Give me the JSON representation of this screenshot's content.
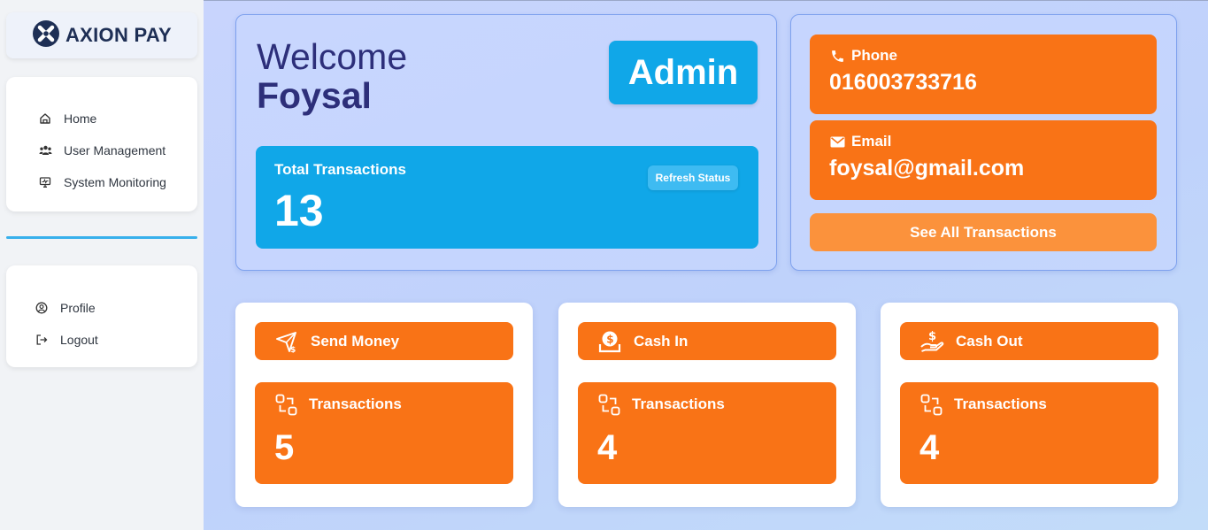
{
  "brand": {
    "name": "AXION PAY",
    "primary_color": "#1e2f55",
    "icon": "x-circle-logo"
  },
  "sidebar": {
    "top_items": [
      {
        "label": "Home",
        "icon": "home-icon"
      },
      {
        "label": "User Management",
        "icon": "users-icon"
      },
      {
        "label": "System Monitoring",
        "icon": "monitor-icon"
      }
    ],
    "bottom_items": [
      {
        "label": "Profile",
        "icon": "user-circle-icon"
      },
      {
        "label": "Logout",
        "icon": "logout-icon"
      }
    ],
    "divider_color": "#38b0ec"
  },
  "welcome": {
    "greeting": "Welcome",
    "name": "Foysal",
    "role_badge": "Admin"
  },
  "total_transactions": {
    "label": "Total Transactions",
    "value": "13",
    "refresh_label": "Refresh Status"
  },
  "contact": {
    "phone_label": "Phone",
    "phone_value": "016003733716",
    "email_label": "Email",
    "email_value": "foysal@gmail.com",
    "see_all_label": "See All Transactions"
  },
  "operations": [
    {
      "title": "Send Money",
      "icon": "send-money-icon",
      "tx_label": "Transactions",
      "tx_value": "5"
    },
    {
      "title": "Cash In",
      "icon": "cash-in-icon",
      "tx_label": "Transactions",
      "tx_value": "4"
    },
    {
      "title": "Cash Out",
      "icon": "cash-out-icon",
      "tx_label": "Transactions",
      "tx_value": "4"
    }
  ],
  "colors": {
    "accent_blue": "#10a7e8",
    "accent_orange": "#f97316",
    "accent_orange_light": "#fb923c",
    "title_navy": "#2d2f7a"
  }
}
